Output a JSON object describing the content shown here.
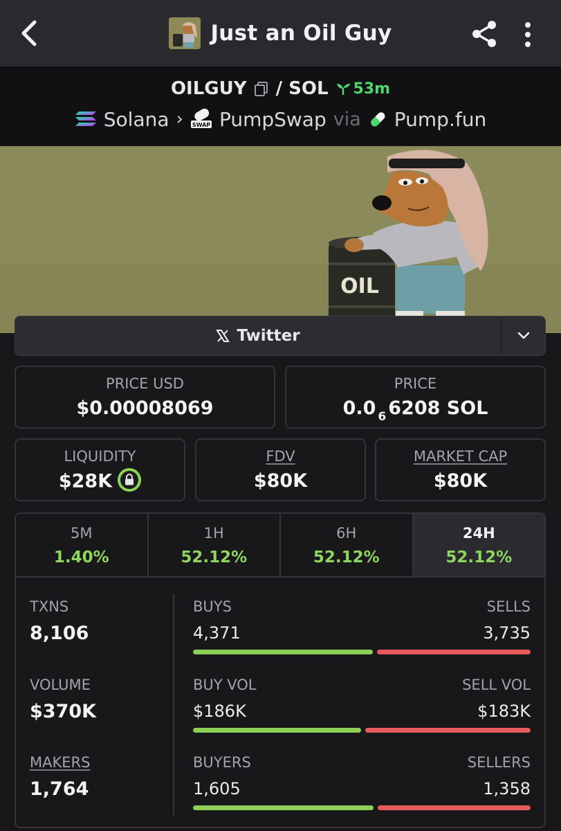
{
  "header": {
    "title": "Just an Oil Guy",
    "back_icon": "chevron-left-icon",
    "share_icon": "share-icon",
    "menu_icon": "kebab-menu-icon"
  },
  "pair": {
    "base": "OILGUY",
    "quote": "/ SOL",
    "age": "53m",
    "chain": "Solana",
    "dex": "PumpSwap",
    "via": "via",
    "launchpad": "Pump.fun"
  },
  "banner": {
    "barrel_text": "OIL"
  },
  "twitter": {
    "label": "Twitter"
  },
  "price": {
    "usd_label": "PRICE USD",
    "usd_value": "$0.00008069",
    "native_label": "PRICE",
    "native_prefix": "0.0",
    "native_subscript": "6",
    "native_rest": "6208 SOL"
  },
  "metrics": {
    "liquidity_label": "LIQUIDITY",
    "liquidity_value": "$28K",
    "fdv_label": "FDV",
    "fdv_value": "$80K",
    "mcap_label": "MARKET CAP",
    "mcap_value": "$80K"
  },
  "timeframes": [
    {
      "label": "5M",
      "change": "1.40%"
    },
    {
      "label": "1H",
      "change": "52.12%"
    },
    {
      "label": "6H",
      "change": "52.12%"
    },
    {
      "label": "24H",
      "change": "52.12%",
      "active": true
    }
  ],
  "stats": {
    "txns_label": "TXNS",
    "txns_value": "8,106",
    "volume_label": "VOLUME",
    "volume_value": "$370K",
    "makers_label": "MAKERS",
    "makers_value": "1,764",
    "buys_label": "BUYS",
    "buys_value": "4,371",
    "sells_label": "SELLS",
    "sells_value": "3,735",
    "buy_vol_label": "BUY VOL",
    "buy_vol_value": "$186K",
    "sell_vol_label": "SELL VOL",
    "sell_vol_value": "$183K",
    "buyers_label": "BUYERS",
    "buyers_value": "1,605",
    "sellers_label": "SELLERS",
    "sellers_value": "1,358",
    "buy_share_txns": 0.539,
    "buy_share_volume": 0.504,
    "buy_share_makers": 0.542
  },
  "colors": {
    "positive": "#8ed65d",
    "negative": "#e85b5b",
    "age": "#4ed86b"
  }
}
